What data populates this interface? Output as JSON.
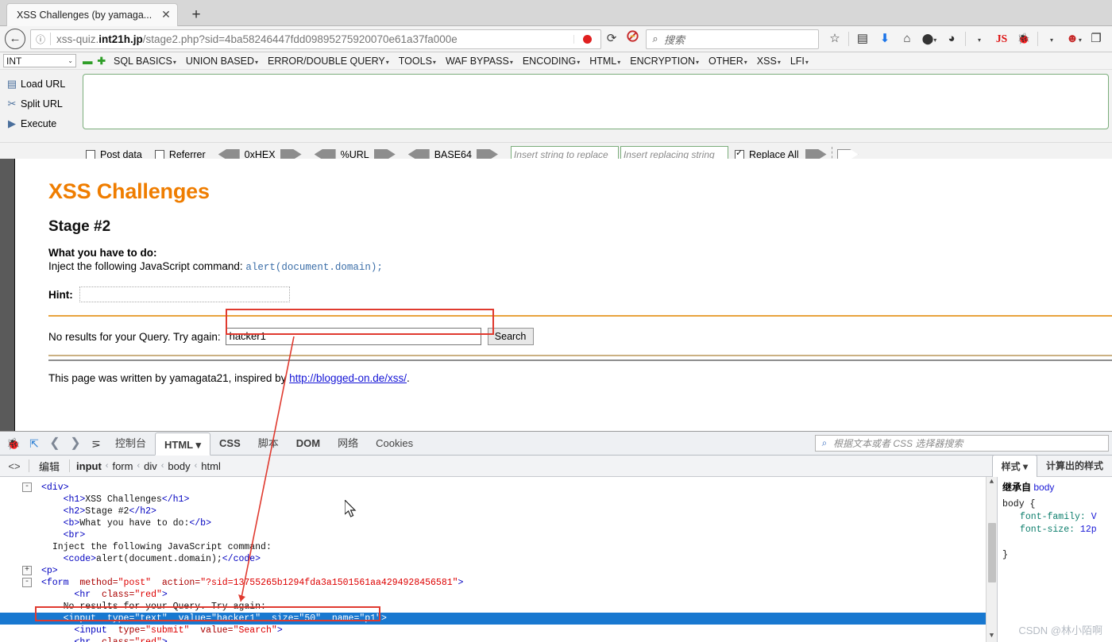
{
  "browser": {
    "tab_title": "XSS Challenges (by yamaga...",
    "tab_close": "✕",
    "new_tab": "+",
    "back_icon": "←",
    "url_info_icon": "ⓘ",
    "url_prefix": "xss-quiz.",
    "url_domain": "int21h.jp",
    "url_suffix": "/stage2.php?sid=4ba58246447fdd09895275920070e61a37fa000e",
    "reload_icon": "⟳",
    "noscript_icon": "🚫",
    "search_icon": "⌕",
    "search_placeholder": "搜索",
    "icons": [
      "star-icon",
      "reader-icon",
      "download-icon",
      "home-icon",
      "account-icon",
      "cookie-icon",
      "js-icon",
      "firebug-icon",
      "noscript-icon",
      "tabs-icon"
    ],
    "js_label": "JS"
  },
  "hackbar": {
    "select_value": "INT",
    "minus": "▬",
    "plus": "✚",
    "menus": [
      "SQL BASICS",
      "UNION BASED",
      "ERROR/DOUBLE QUERY",
      "TOOLS",
      "WAF BYPASS",
      "ENCODING",
      "HTML",
      "ENCRYPTION",
      "OTHER",
      "XSS",
      "LFI"
    ],
    "actions": [
      {
        "label": "Load URL",
        "icon": "load-url-icon"
      },
      {
        "label": "Split URL",
        "icon": "split-url-icon"
      },
      {
        "label": "Execute",
        "icon": "execute-icon"
      }
    ],
    "url_textarea_value": "",
    "post_data_label": "Post data",
    "post_data_checked": false,
    "referrer_label": "Referrer",
    "referrer_checked": false,
    "encoders": [
      "0xHEX",
      "%URL",
      "BASE64"
    ],
    "replace_from_placeholder": "Insert string to replace",
    "replace_to_placeholder": "Insert replacing string",
    "replace_all_label": "Replace All",
    "replace_all_checked": true
  },
  "page": {
    "title": "XSS Challenges",
    "stage": "Stage #2",
    "task_label": "What you have to do:",
    "task_text": "Inject the following JavaScript command: ",
    "task_code": "alert(document.domain);",
    "hint_label": "Hint:",
    "hint_value": "",
    "query_text": "No results for your Query. Try again:",
    "query_value": "hacker1",
    "search_button": "Search",
    "footer_pre": "This page was written by yamagata21, inspired by ",
    "footer_link": "http://blogged-on.de/xss/",
    "footer_post": "."
  },
  "firebug": {
    "toolbar_icons": [
      "firebug-icon",
      "inspect-icon",
      "prev-icon",
      "next-icon",
      "indent-icon"
    ],
    "prev": "❮",
    "next": "❯",
    "indent": "⋝",
    "tabs": [
      {
        "label": "控制台",
        "active": false
      },
      {
        "label": "HTML",
        "active": true,
        "caret": "▾"
      },
      {
        "label": "CSS",
        "active": false
      },
      {
        "label": "脚本",
        "active": false
      },
      {
        "label": "DOM",
        "active": false
      },
      {
        "label": "网络",
        "active": false
      },
      {
        "label": "Cookies",
        "active": false
      }
    ],
    "search_icon": "⌕",
    "search_placeholder": "根据文本或者 CSS 选择器搜索",
    "crumb_icon": "<>",
    "edit_label": "编辑",
    "breadcrumbs": [
      "input",
      "form",
      "div",
      "body",
      "html"
    ],
    "breadcrumb_sep": "‹",
    "html_lines": [
      {
        "indent": 0,
        "twisty": "-",
        "parts": [
          [
            "tg",
            "<div>"
          ]
        ]
      },
      {
        "indent": 2,
        "twisty": "",
        "parts": [
          [
            "tg",
            "<h1>"
          ],
          [
            "txt",
            "XSS Challenges"
          ],
          [
            "tg",
            "</h1>"
          ]
        ]
      },
      {
        "indent": 2,
        "twisty": "",
        "parts": [
          [
            "tg",
            "<h2>"
          ],
          [
            "txt",
            "Stage #2"
          ],
          [
            "tg",
            "</h2>"
          ]
        ]
      },
      {
        "indent": 2,
        "twisty": "",
        "parts": [
          [
            "tg",
            "<b>"
          ],
          [
            "txt",
            "What you have to do:"
          ],
          [
            "tg",
            "</b>"
          ]
        ]
      },
      {
        "indent": 2,
        "twisty": "",
        "parts": [
          [
            "tg",
            "<br>"
          ]
        ]
      },
      {
        "indent": 1,
        "twisty": "",
        "parts": [
          [
            "txt",
            "Inject the following JavaScript command:"
          ]
        ]
      },
      {
        "indent": 2,
        "twisty": "",
        "parts": [
          [
            "tg",
            "<code>"
          ],
          [
            "txt",
            "alert(document.domain);"
          ],
          [
            "tg",
            "</code>"
          ]
        ]
      },
      {
        "indent": 0,
        "twisty": "+",
        "parts": [
          [
            "tg",
            "<p>"
          ]
        ]
      },
      {
        "indent": 0,
        "twisty": "-",
        "parts": [
          [
            "tg",
            "<form"
          ],
          [
            "at",
            "  method="
          ],
          [
            "av",
            "\"post\""
          ],
          [
            "at",
            "  action="
          ],
          [
            "av",
            "\"?sid=13755265b1294fda3a1501561aa4294928456581\""
          ],
          [
            "tg",
            ">"
          ]
        ]
      },
      {
        "indent": 3,
        "twisty": "",
        "parts": [
          [
            "tg",
            "<hr"
          ],
          [
            "at",
            "  class="
          ],
          [
            "av",
            "\"red\""
          ],
          [
            "tg",
            ">"
          ]
        ]
      },
      {
        "indent": 2,
        "twisty": "",
        "parts": [
          [
            "txt",
            "No results for your Query. Try again:"
          ]
        ]
      },
      {
        "indent": 2,
        "twisty": "",
        "selected": true,
        "parts": [
          [
            "tg",
            "<input"
          ],
          [
            "at",
            "  type="
          ],
          [
            "av",
            "\"text\""
          ],
          [
            "at",
            "  value="
          ],
          [
            "av",
            "\"hacker1\""
          ],
          [
            "at",
            "  size="
          ],
          [
            "av",
            "\"50\""
          ],
          [
            "at",
            "  name="
          ],
          [
            "av",
            "\"p1\""
          ],
          [
            "tg",
            ">"
          ]
        ]
      },
      {
        "indent": 3,
        "twisty": "",
        "parts": [
          [
            "tg",
            "<input"
          ],
          [
            "at",
            "  type="
          ],
          [
            "av",
            "\"submit\""
          ],
          [
            "at",
            "  value="
          ],
          [
            "av",
            "\"Search\""
          ],
          [
            "tg",
            ">"
          ]
        ]
      },
      {
        "indent": 3,
        "twisty": "",
        "parts": [
          [
            "tg",
            "<hr"
          ],
          [
            "at",
            "  class="
          ],
          [
            "av",
            "\"red\""
          ],
          [
            "tg",
            ">"
          ]
        ]
      }
    ],
    "style_tabs": [
      {
        "label": "样式",
        "active": true,
        "caret": "▾"
      },
      {
        "label": "计算出的样式",
        "active": false
      }
    ],
    "inherit_label": "继承自",
    "inherit_element": "body",
    "css_selector": "body {",
    "css_props": [
      {
        "name": "font-family:",
        "value": "V"
      },
      {
        "name": "font-size:",
        "value": "12p"
      }
    ],
    "css_close": "}",
    "scroll_up": "︿",
    "scroll_down": "﹀"
  },
  "watermark": "CSDN @林小陌啊",
  "colors": {
    "brand_orange": "#ef7d00",
    "highlight_red": "#e03a2f",
    "selection_blue": "#1878d0",
    "link_blue": "#1414d6"
  }
}
